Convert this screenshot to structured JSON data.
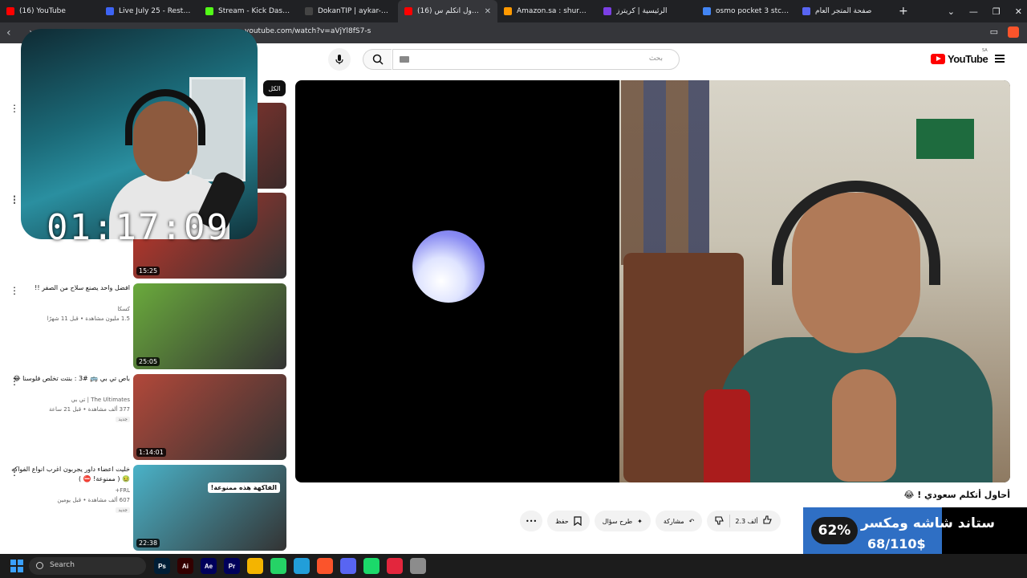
{
  "browser": {
    "tabs": [
      {
        "title": "(16) YouTube",
        "color": "#ff0000",
        "active": false
      },
      {
        "title": "Live July 25 - Restream",
        "color": "#3d64f5",
        "active": false
      },
      {
        "title": "Stream - Kick Dashbo",
        "color": "#53fc18",
        "active": false
      },
      {
        "title": "DokanTIP | aykar-ksa",
        "color": "#444444",
        "active": false
      },
      {
        "title": "(16) أحاول أتكلم س...",
        "color": "#ff0000",
        "active": true
      },
      {
        "title": "Amazon.sa : shure mv7 pl",
        "color": "#ff9900",
        "active": false
      },
      {
        "title": "الرئيسية | كريترز",
        "color": "#7b3fe4",
        "active": false
      },
      {
        "title": "osmo pocket 3 stc - Goog",
        "color": "#4285f4",
        "active": false
      },
      {
        "title": "صفحة المتجر العام",
        "color": "#5865f2",
        "active": false
      }
    ],
    "new_tab": "+",
    "url": "youtube.com/watch?v=aVjYl8fS7-s"
  },
  "youtube": {
    "logo_text": "YouTube",
    "country_code": "SA",
    "search_placeholder": "بحث"
  },
  "stream_overlay": {
    "timer": "01:17:09",
    "goal_percent": "62%",
    "goal_percent_value": 62,
    "goal_label": "ستاند شاشه ومكسر",
    "goal_amount": "68/110$"
  },
  "filter_chip": "الكل",
  "related": [
    {
      "duration": "15:25",
      "title": "",
      "channel": "",
      "meta": "",
      "thumb_color": "#c9362a"
    },
    {
      "duration": "25:05",
      "title": "افضل واحد يصنع سلاح من الصفر !!",
      "channel": "كسكا",
      "meta": "1.5 مليون مشاهدة • قبل 11 شهرًا",
      "thumb_color": "#6aaa3c"
    },
    {
      "duration": "1:14:01",
      "title": "باص تي بي 🚌 #3 : بنتت تخلص فلوسنا 😂",
      "channel": "The Ultimates | تي بي",
      "meta": "377 ألف مشاهدة • قبل 21 ساعة",
      "badge": "جديد",
      "thumb_color": "#b2483a"
    },
    {
      "duration": "22:38",
      "title": "خليت اعضاء داور يجربون اغرب انواع الفواكه 🤢 ( ممنوعة! ⛔ )",
      "channel": "FRL+",
      "meta": "607 ألف مشاهدة • قبل يومين",
      "badge": "جديد",
      "thumb_text": "الفاكهة هذه ممنوعة!",
      "thumb_color": "#4ab2c8"
    }
  ],
  "video": {
    "title": "أحاول أتكلم سعودي ! 😂",
    "likes": "2.3 ألف",
    "share": "مشاركة",
    "ask": "طرح سؤال",
    "save": "حفظ"
  },
  "taskbar": {
    "search_label": "Search",
    "apps": [
      {
        "label": "Ps",
        "color": "#001e36"
      },
      {
        "label": "Ai",
        "color": "#330000"
      },
      {
        "label": "Ae",
        "color": "#00005b"
      },
      {
        "label": "Pr",
        "color": "#00005b"
      },
      {
        "label": "",
        "color": "#f4b400"
      },
      {
        "label": "",
        "color": "#25d366"
      },
      {
        "label": "",
        "color": "#229ed9"
      },
      {
        "label": "",
        "color": "#fb542b"
      },
      {
        "label": "",
        "color": "#5865f2"
      },
      {
        "label": "",
        "color": "#1bd96a"
      },
      {
        "label": "",
        "color": "#e3263d"
      },
      {
        "label": "",
        "color": "#8c8c8c"
      }
    ]
  }
}
